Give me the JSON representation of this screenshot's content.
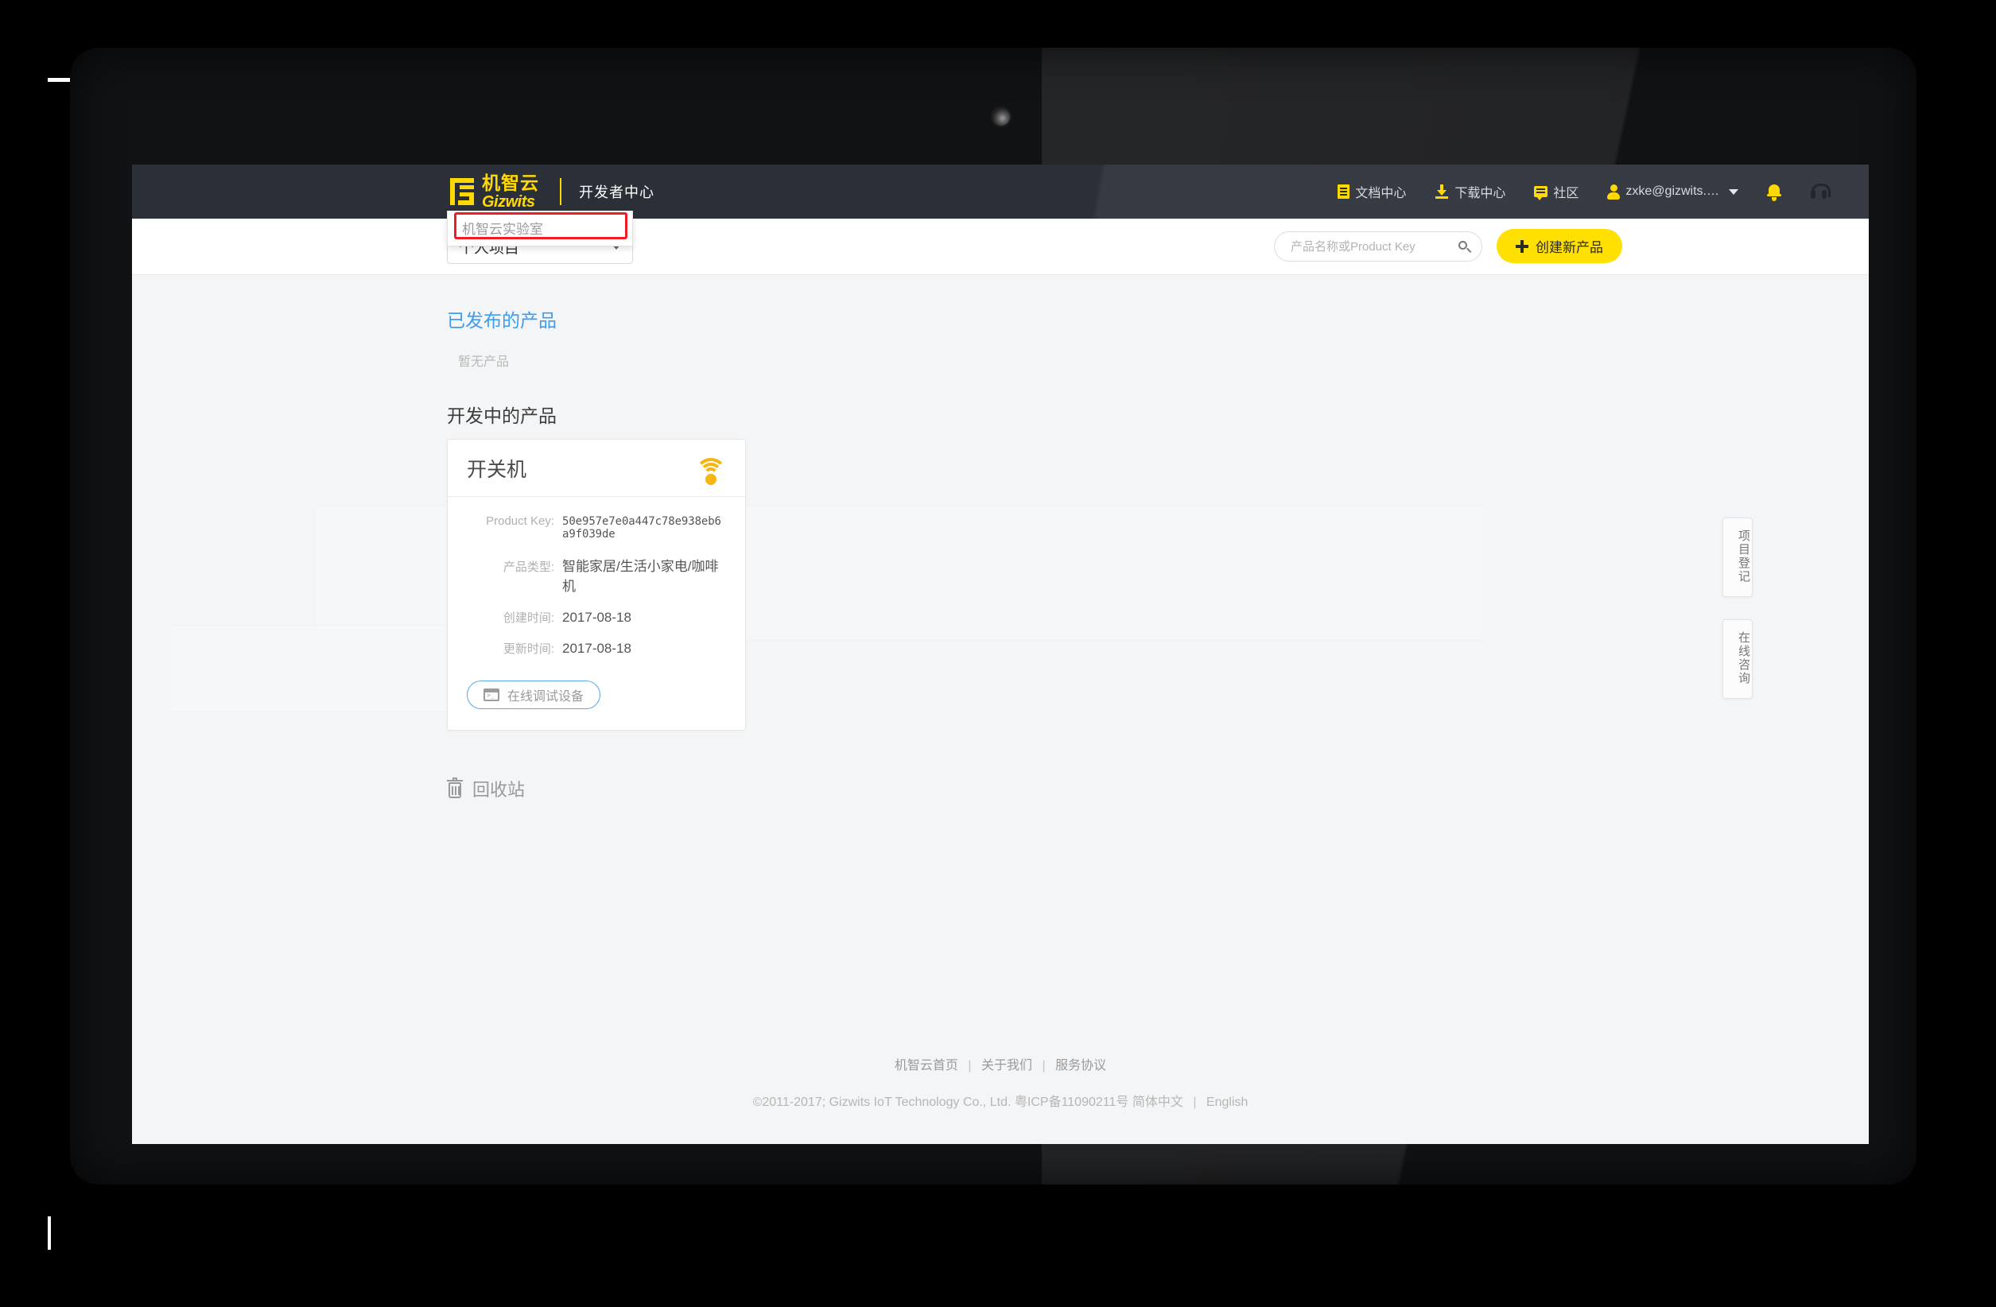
{
  "navbar": {
    "logo_cn": "机智云",
    "logo_en": "Gizwits",
    "subtitle": "开发者中心",
    "items": [
      {
        "label": "文档中心",
        "icon": "document-icon"
      },
      {
        "label": "下载中心",
        "icon": "download-icon"
      },
      {
        "label": "社区",
        "icon": "community-icon"
      },
      {
        "label": "zxke@gizwits.…",
        "icon": "user-icon"
      }
    ],
    "bell_icon": "bell-icon",
    "headset_icon": "headset-icon"
  },
  "subbar": {
    "project_select": {
      "selected": "个人项目",
      "options": [
        "机智云实验室"
      ]
    },
    "search": {
      "placeholder": "产品名称或Product Key",
      "value": "",
      "icon": "search-icon"
    },
    "create_button": "创建新产品"
  },
  "main": {
    "published_title": "已发布的产品",
    "published_empty": "暂无产品",
    "developing_title": "开发中的产品",
    "product": {
      "name": "开关机",
      "connection_icon": "wifi-icon",
      "fields": [
        {
          "key": "Product Key:",
          "value": "50e957e7e0a447c78e938eb6a9f039de"
        },
        {
          "key": "产品类型:",
          "value": "智能家居/生活小家电/咖啡机"
        },
        {
          "key": "创建时间:",
          "value": "2017-08-18"
        },
        {
          "key": "更新时间:",
          "value": "2017-08-18"
        }
      ],
      "debug_button": "在线调试设备"
    },
    "recycle_bin": "回收站"
  },
  "side_tabs": [
    {
      "label": "项目登记"
    },
    {
      "label": "在线咨询"
    }
  ],
  "footer": {
    "links": [
      "机智云首页",
      "关于我们",
      "服务协议"
    ],
    "copyright": "©2011-2017; Gizwits IoT Technology Co., Ltd. 粤ICP备11090211号",
    "lang_cn": "简体中文",
    "lang_en": "English"
  },
  "colors": {
    "brand_yellow": "#ffd900",
    "navbar_bg": "#2b3038",
    "accent_blue": "#3d9cf0",
    "highlight_red": "#ee1c25",
    "wifi_amber": "#f5b612"
  }
}
